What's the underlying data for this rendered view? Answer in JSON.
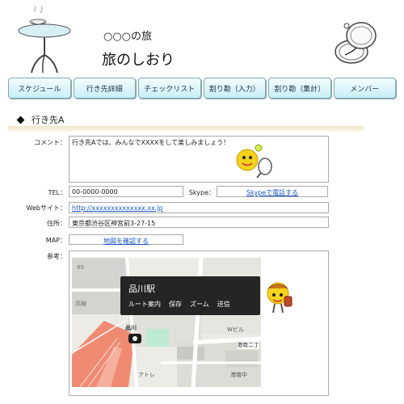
{
  "header": {
    "subtitle": "○○○の旅",
    "title": "旅のしおり"
  },
  "nav": {
    "items": [
      "スケジュール",
      "行き先詳細",
      "チェックリスト",
      "割り勘（入力）",
      "割り勘（集計）",
      "メンバー"
    ]
  },
  "section": {
    "title": "行き先A"
  },
  "form": {
    "comment_label": "コメント：",
    "comment_value": "行き先Aでは、みんなでXXXXをして楽しみましょう！",
    "tel_label": "TEL：",
    "tel_value": "00-0000-0000",
    "skype_label": "Skype：",
    "skype_link": "Skypeで電話する",
    "web_label": "Webサイト：",
    "web_value": "http://xxxxxxxxxxxxxx.xx.jp",
    "address_label": "住所：",
    "address_value": "東京都渋谷区神宮前3-27-15",
    "map_label": "MAP：",
    "map_link": "地図を確認する",
    "ref_label": "参考："
  },
  "map": {
    "station_name": "品川駅",
    "actions": [
      "ルート案内",
      "保存",
      "ズーム",
      "送信"
    ],
    "labels": {
      "shinagawa": "品川",
      "takanawa": "高輪",
      "w_building": "Wビル",
      "harbor": "港南二丁",
      "atore": "アトレ",
      "port_school": "港南中",
      "number": "89"
    }
  },
  "colors": {
    "nav_border": "#7fa9b8",
    "link": "#1a57c8",
    "popup_bg": "#252525",
    "section_band": "#f0e7c6",
    "map_railway": "#f08a72"
  }
}
